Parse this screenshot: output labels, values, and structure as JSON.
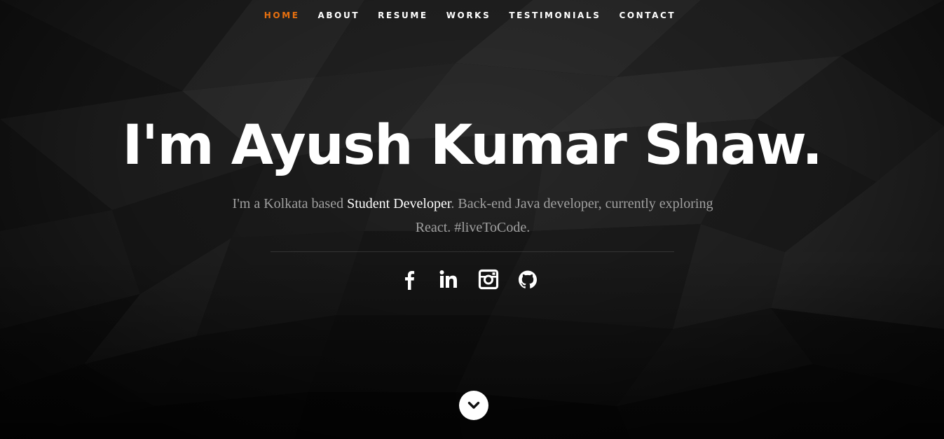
{
  "nav": {
    "items": [
      {
        "label": "Home",
        "active": true
      },
      {
        "label": "About",
        "active": false
      },
      {
        "label": "Resume",
        "active": false
      },
      {
        "label": "Works",
        "active": false
      },
      {
        "label": "Testimonials",
        "active": false
      },
      {
        "label": "Contact",
        "active": false
      }
    ],
    "active_color": "#e8700f"
  },
  "hero": {
    "headline": "I'm Ayush Kumar Shaw.",
    "intro_before": "I'm a Kolkata based ",
    "intro_highlight": "Student Developer",
    "intro_after": ". Back-end Java developer, currently exploring React. #liveToCode."
  },
  "social": [
    {
      "icon": "facebook-icon"
    },
    {
      "icon": "linkedin-icon"
    },
    {
      "icon": "instagram-icon"
    },
    {
      "icon": "github-icon"
    }
  ],
  "scroll_down": {
    "icon": "chevron-down-icon"
  }
}
